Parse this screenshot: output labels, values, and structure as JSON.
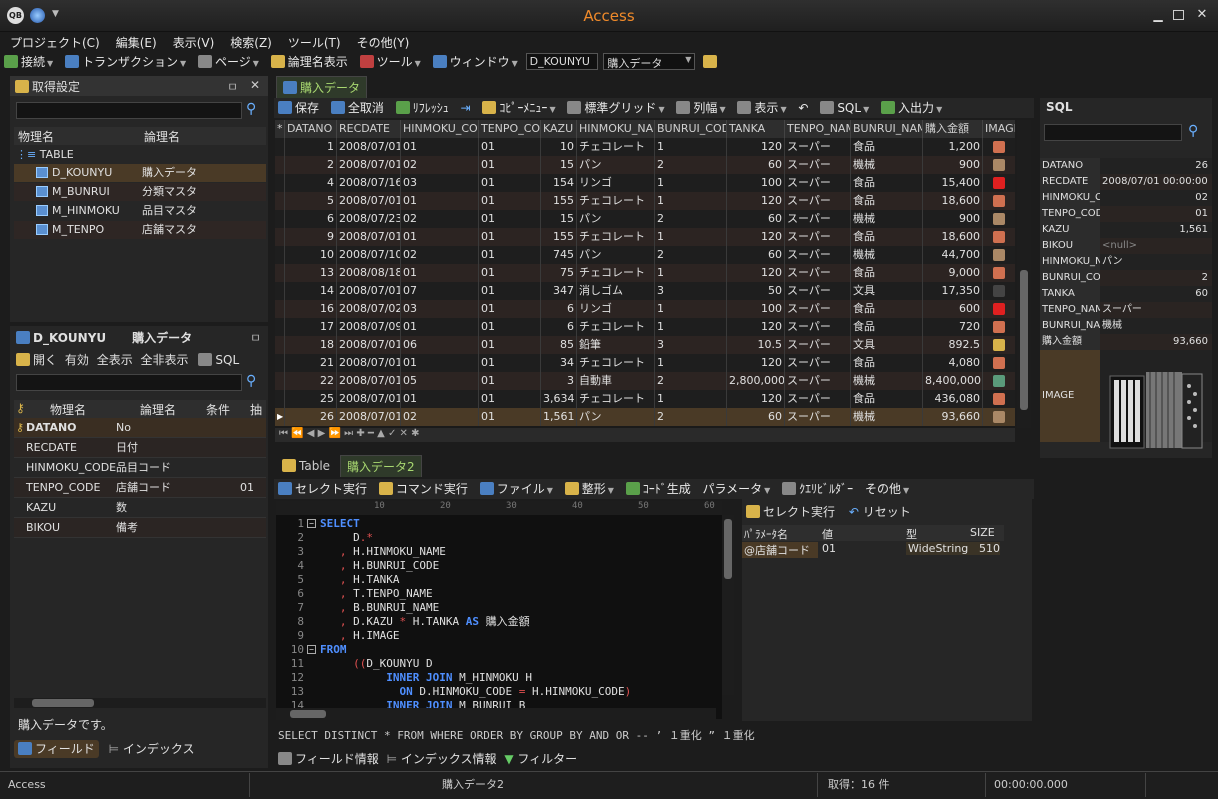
{
  "app": {
    "title": "Access"
  },
  "menu": [
    "プロジェクト(C)",
    "編集(E)",
    "表示(V)",
    "検索(Z)",
    "ツール(T)",
    "その他(Y)"
  ],
  "toolbar": {
    "connect": "接続",
    "transaction": "トランザクション",
    "page": "ページ",
    "logical_name": "論理名表示",
    "tool": "ツール",
    "window": "ウィンドウ",
    "table_input": "D_KOUNYU",
    "table_logical": "購入データ"
  },
  "fetch_panel": {
    "title": "取得設定",
    "columns": [
      "物理名",
      "論理名"
    ],
    "root": "TABLE",
    "tables": [
      {
        "name": "D_KOUNYU",
        "logical": "購入データ",
        "selected": true
      },
      {
        "name": "M_BUNRUI",
        "logical": "分類マスタ"
      },
      {
        "name": "M_HINMOKU",
        "logical": "品目マスタ"
      },
      {
        "name": "M_TENPO",
        "logical": "店舗マスタ"
      }
    ]
  },
  "field_panel": {
    "table": "D_KOUNYU",
    "table_logical": "購入データ",
    "actions": [
      "開く",
      "有効",
      "全表示",
      "全非表示",
      "SQL"
    ],
    "columns": [
      "物理名",
      "論理名",
      "条件",
      "抽"
    ],
    "fields": [
      {
        "name": "DATANO",
        "logical": "No",
        "cond": "",
        "key": true
      },
      {
        "name": "RECDATE",
        "logical": "日付",
        "cond": ""
      },
      {
        "name": "HINMOKU_CODE",
        "logical": "品目コード",
        "cond": ""
      },
      {
        "name": "TENPO_CODE",
        "logical": "店舗コード",
        "cond": "01"
      },
      {
        "name": "KAZU",
        "logical": "数",
        "cond": ""
      },
      {
        "name": "BIKOU",
        "logical": "備考",
        "cond": ""
      }
    ],
    "description": "購入データです。",
    "tab_field": "フィールド",
    "tab_index": "インデックス"
  },
  "data_tab": {
    "title": "購入データ",
    "toolbar": [
      "保存",
      "全取消",
      "ﾘﾌﾚｯｼｭ",
      "ｺﾋﾟｰﾒﾆｭｰ",
      "標準グリッド",
      "列幅",
      "表示",
      "SQL",
      "入出力"
    ],
    "columns": [
      "DATANO",
      "RECDATE",
      "HINMOKU_CODE",
      "TENPO_CODE",
      "KAZU",
      "HINMOKU_NAME",
      "BUNRUI_CODE",
      "TANKA",
      "TENPO_NAME",
      "BUNRUI_NAME",
      "購入金額",
      "IMAGE"
    ],
    "rows": [
      [
        "1",
        "2008/07/01",
        "01",
        "01",
        "10",
        "チェコレート",
        "1",
        "120",
        "スーパー",
        "食品",
        "1,200"
      ],
      [
        "2",
        "2008/07/01",
        "02",
        "01",
        "15",
        "パン",
        "2",
        "60",
        "スーパー",
        "機械",
        "900"
      ],
      [
        "4",
        "2008/07/16",
        "03",
        "01",
        "154",
        "リンゴ",
        "1",
        "100",
        "スーパー",
        "食品",
        "15,400"
      ],
      [
        "5",
        "2008/07/01",
        "01",
        "01",
        "155",
        "チェコレート",
        "1",
        "120",
        "スーパー",
        "食品",
        "18,600"
      ],
      [
        "6",
        "2008/07/23",
        "02",
        "01",
        "15",
        "パン",
        "2",
        "60",
        "スーパー",
        "機械",
        "900"
      ],
      [
        "9",
        "2008/07/01",
        "01",
        "01",
        "155",
        "チェコレート",
        "1",
        "120",
        "スーパー",
        "食品",
        "18,600"
      ],
      [
        "10",
        "2008/07/10",
        "02",
        "01",
        "745",
        "パン",
        "2",
        "60",
        "スーパー",
        "機械",
        "44,700"
      ],
      [
        "13",
        "2008/08/18",
        "01",
        "01",
        "75",
        "チェコレート",
        "1",
        "120",
        "スーパー",
        "食品",
        "9,000"
      ],
      [
        "14",
        "2008/07/01",
        "07",
        "01",
        "347",
        "消しゴム",
        "3",
        "50",
        "スーパー",
        "文具",
        "17,350"
      ],
      [
        "16",
        "2008/07/02",
        "03",
        "01",
        "6",
        "リンゴ",
        "1",
        "100",
        "スーパー",
        "食品",
        "600"
      ],
      [
        "17",
        "2008/07/09",
        "01",
        "01",
        "6",
        "チェコレート",
        "1",
        "120",
        "スーパー",
        "食品",
        "720"
      ],
      [
        "18",
        "2008/07/01",
        "06",
        "01",
        "85",
        "鉛筆",
        "3",
        "10.5",
        "スーパー",
        "文具",
        "892.5"
      ],
      [
        "21",
        "2008/07/01",
        "01",
        "01",
        "34",
        "チェコレート",
        "1",
        "120",
        "スーパー",
        "食品",
        "4,080"
      ],
      [
        "22",
        "2008/07/01",
        "05",
        "01",
        "3",
        "自動車",
        "2",
        "2,800,000",
        "スーパー",
        "機械",
        "8,400,000"
      ],
      [
        "25",
        "2008/07/01",
        "01",
        "01",
        "3,634",
        "チェコレート",
        "1",
        "120",
        "スーパー",
        "食品",
        "436,080"
      ],
      [
        "26",
        "2008/07/01",
        "02",
        "01",
        "1,561",
        "パン",
        "2",
        "60",
        "スーパー",
        "機械",
        "93,660"
      ]
    ]
  },
  "query_tabs": {
    "tab1": "Table",
    "tab2": "購入データ2"
  },
  "query_toolbar": [
    "セレクト実行",
    "コマンド実行",
    "ファイル",
    "整形",
    "ｺｰﾄﾞ生成",
    "パラメータ",
    "ｸｴﾘﾋﾞﾙﾀﾞｰ",
    "その他"
  ],
  "ruler": [
    "10",
    "20",
    "30",
    "40",
    "50",
    "60"
  ],
  "sql_lines": [
    [
      [
        "kw",
        "SELECT"
      ]
    ],
    [
      [
        "id",
        "     D"
      ],
      [
        "sym",
        ".*"
      ]
    ],
    [
      [
        "id",
        "   "
      ],
      [
        "sym",
        ", "
      ],
      [
        "id",
        "H.HINMOKU_NAME"
      ]
    ],
    [
      [
        "id",
        "   "
      ],
      [
        "sym",
        ", "
      ],
      [
        "id",
        "H.BUNRUI_CODE"
      ]
    ],
    [
      [
        "id",
        "   "
      ],
      [
        "sym",
        ", "
      ],
      [
        "id",
        "H.TANKA"
      ]
    ],
    [
      [
        "id",
        "   "
      ],
      [
        "sym",
        ", "
      ],
      [
        "id",
        "T.TENPO_NAME"
      ]
    ],
    [
      [
        "id",
        "   "
      ],
      [
        "sym",
        ", "
      ],
      [
        "id",
        "B.BUNRUI_NAME"
      ]
    ],
    [
      [
        "id",
        "   "
      ],
      [
        "sym",
        ", "
      ],
      [
        "id",
        "D.KAZU "
      ],
      [
        "sym",
        "* "
      ],
      [
        "id",
        "H.TANKA "
      ],
      [
        "kw",
        "AS "
      ],
      [
        "id",
        "購入金額"
      ]
    ],
    [
      [
        "id",
        "   "
      ],
      [
        "sym",
        ", "
      ],
      [
        "id",
        "H.IMAGE"
      ]
    ],
    [
      [
        "kw",
        "FROM"
      ]
    ],
    [
      [
        "id",
        "     "
      ],
      [
        "sym",
        "(("
      ],
      [
        "id",
        "D_KOUNYU D"
      ]
    ],
    [
      [
        "id",
        "          "
      ],
      [
        "kw",
        "INNER JOIN "
      ],
      [
        "id",
        "M_HINMOKU H"
      ]
    ],
    [
      [
        "id",
        "            "
      ],
      [
        "kw",
        "ON "
      ],
      [
        "id",
        "D.HINMOKU_CODE "
      ],
      [
        "sym",
        "= "
      ],
      [
        "id",
        "H.HINMOKU_CODE"
      ],
      [
        "sym",
        ")"
      ]
    ],
    [
      [
        "id",
        "          "
      ],
      [
        "kw",
        "INNER JOIN "
      ],
      [
        "id",
        "M_BUNRUI B"
      ]
    ]
  ],
  "sql_keywords_bar": "SELECT DISTINCT * FROM WHERE ORDER BY GROUP BY AND OR --  ’ １重化  ” １重化",
  "bottom_tabs": [
    "フィールド情報",
    "インデックス情報",
    "フィルター"
  ],
  "param_panel": {
    "run": "セレクト実行",
    "reset": "リセット",
    "columns": [
      "ﾊﾟﾗﾒｰﾀ名",
      "値",
      "型",
      "SIZE"
    ],
    "rows": [
      [
        "@店舗コード",
        "01",
        "WideString",
        "510"
      ]
    ]
  },
  "sql_panel": {
    "title": "SQL",
    "fields": [
      [
        "DATANO",
        "26"
      ],
      [
        "RECDATE",
        "2008/07/01 00:00:00"
      ],
      [
        "HINMOKU_CO",
        "02"
      ],
      [
        "TENPO_CODE",
        "01"
      ],
      [
        "KAZU",
        "1,561"
      ],
      [
        "BIKOU",
        "<null>"
      ],
      [
        "HINMOKU_NA",
        "パン"
      ],
      [
        "BUNRUI_COD",
        "2"
      ],
      [
        "TANKA",
        "60"
      ],
      [
        "TENPO_NAME",
        "スーパー"
      ],
      [
        "BUNRUI_NAM",
        "機械"
      ],
      [
        "購入金額",
        "93,660"
      ],
      [
        "IMAGE",
        ""
      ]
    ]
  },
  "status": {
    "left": "Access",
    "middle": "購入データ2",
    "count": "取得：16 件",
    "time": "00:00:00.000"
  }
}
